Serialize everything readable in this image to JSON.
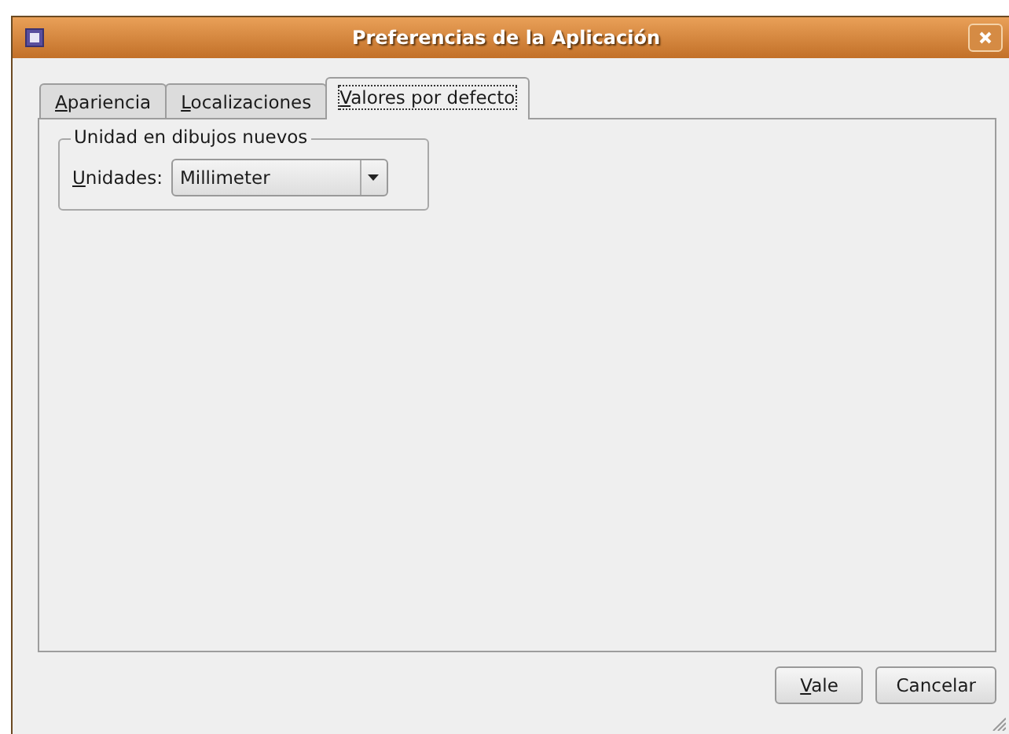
{
  "window": {
    "title": "Preferencias de la Aplicación"
  },
  "tabs": [
    {
      "label": "Apariencia",
      "mnemonic": true,
      "selected": false
    },
    {
      "label": "Localizaciones",
      "mnemonic": true,
      "selected": false
    },
    {
      "label": "Valores por defecto",
      "mnemonic": true,
      "selected": true
    }
  ],
  "group": {
    "title": "Unidad en dibujos nuevos",
    "field_label": "Unidades:",
    "field_label_mnemonic": true,
    "value": "Millimeter"
  },
  "buttons": [
    {
      "label": "Vale",
      "mnemonic": true
    },
    {
      "label": "Cancelar",
      "mnemonic": false
    }
  ]
}
